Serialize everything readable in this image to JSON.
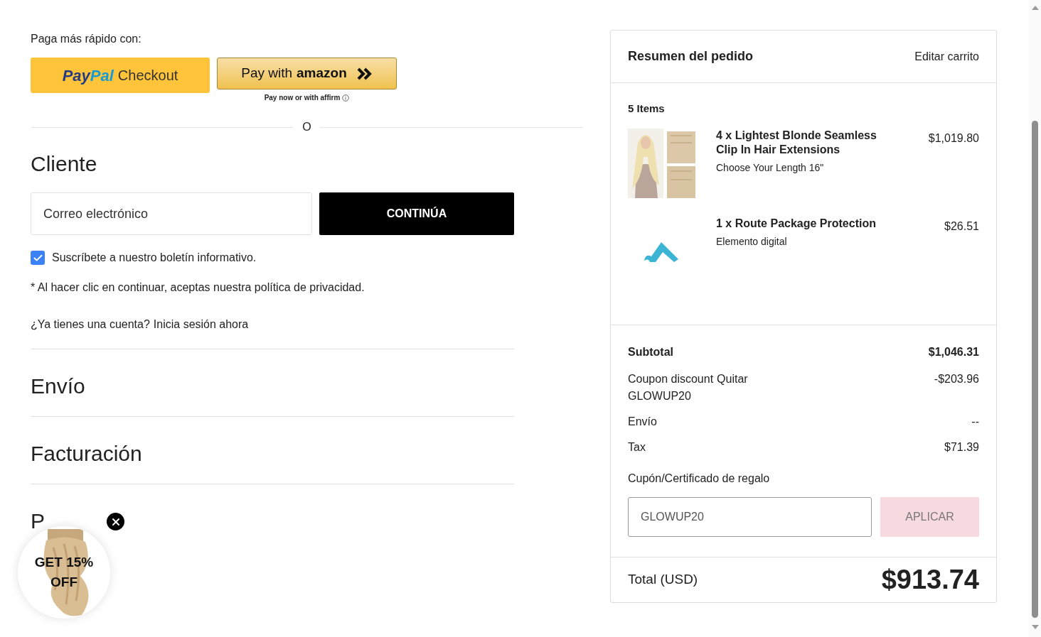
{
  "express": {
    "label": "Paga más rápido con:",
    "paypal": {
      "brand_a": "Pay",
      "brand_b": "Pal",
      "label": "Checkout"
    },
    "amazon": {
      "prefix": "Pay with",
      "brand": "amazon",
      "note_prefix": "Pay now or with",
      "note_brand": "affirm"
    },
    "divider": "O"
  },
  "customer": {
    "heading": "Cliente",
    "email": {
      "placeholder": "Correo electrónico"
    },
    "continue": "CONTINÚA",
    "newsletter": {
      "label": "Suscríbete a nuestro boletín informativo.",
      "checked": true
    },
    "privacy": "* Al hacer clic en continuar, aceptas nuestra política de privacidad.",
    "login_prompt": "¿Ya tienes una cuenta?",
    "login_link": "Inicia sesión ahora"
  },
  "sections": [
    "Envío",
    "Facturación",
    "P"
  ],
  "promo": {
    "line1": "GET 15%",
    "line2": "OFF"
  },
  "summary": {
    "title": "Resumen del pedido",
    "edit": "Editar carrito",
    "count": "5 Items",
    "items": [
      {
        "kind": "hair",
        "name": "4 x Lightest Blonde Seamless Clip In Hair Extensions",
        "option": "Choose Your Length 16\"",
        "price": "$1,019.80"
      },
      {
        "kind": "route",
        "name": "1 x Route Package Protection",
        "option": "Elemento digital",
        "price": "$26.51"
      }
    ],
    "subtotal": {
      "label": "Subtotal",
      "value": "$1,046.31"
    },
    "coupon": {
      "label": "Coupon discount",
      "remove": "Quitar",
      "code": "GLOWUP20",
      "value": "-$203.96"
    },
    "lines": [
      {
        "label": "Envío",
        "value": "--"
      },
      {
        "label": "Tax",
        "value": "$71.39"
      }
    ],
    "gift": {
      "label": "Cupón/Certificado de regalo",
      "value": "GLOWUP20",
      "apply": "APLICAR",
      "disabled": true
    },
    "total": {
      "label": "Total (USD)",
      "value": "$913.74"
    }
  }
}
